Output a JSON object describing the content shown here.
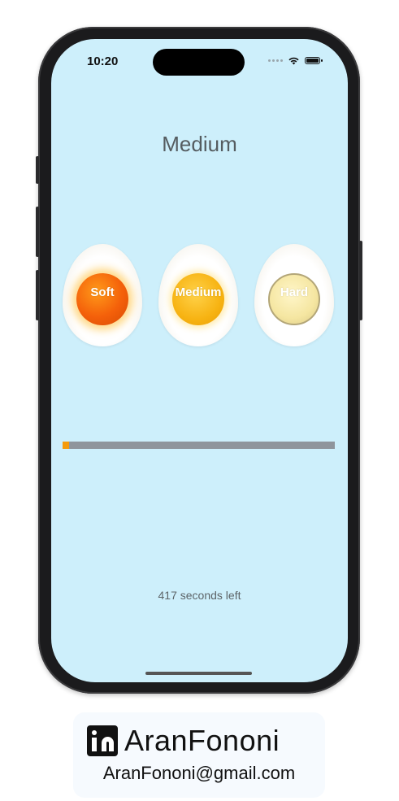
{
  "status_bar": {
    "time": "10:20",
    "signal_icon": "signal-dots-icon",
    "wifi_icon": "wifi-icon",
    "battery_icon": "battery-icon"
  },
  "header": {
    "title": "Medium"
  },
  "eggs": [
    {
      "label": "Soft",
      "yolk_color": "#f4600a"
    },
    {
      "label": "Medium",
      "yolk_color": "#f7b312"
    },
    {
      "label": "Hard",
      "yolk_color": "#f5e6a1"
    }
  ],
  "progress": {
    "value": 0.025,
    "track_color": "#8f959c",
    "fill_color": "#f59b0b"
  },
  "timer": {
    "text": "417 seconds left"
  },
  "signature": {
    "icon": "linkedin-icon",
    "name": "AranFononi",
    "email": "AranFononi@gmail.com"
  },
  "colors": {
    "background": "#cdeffb",
    "accent": "#f59b0b"
  }
}
